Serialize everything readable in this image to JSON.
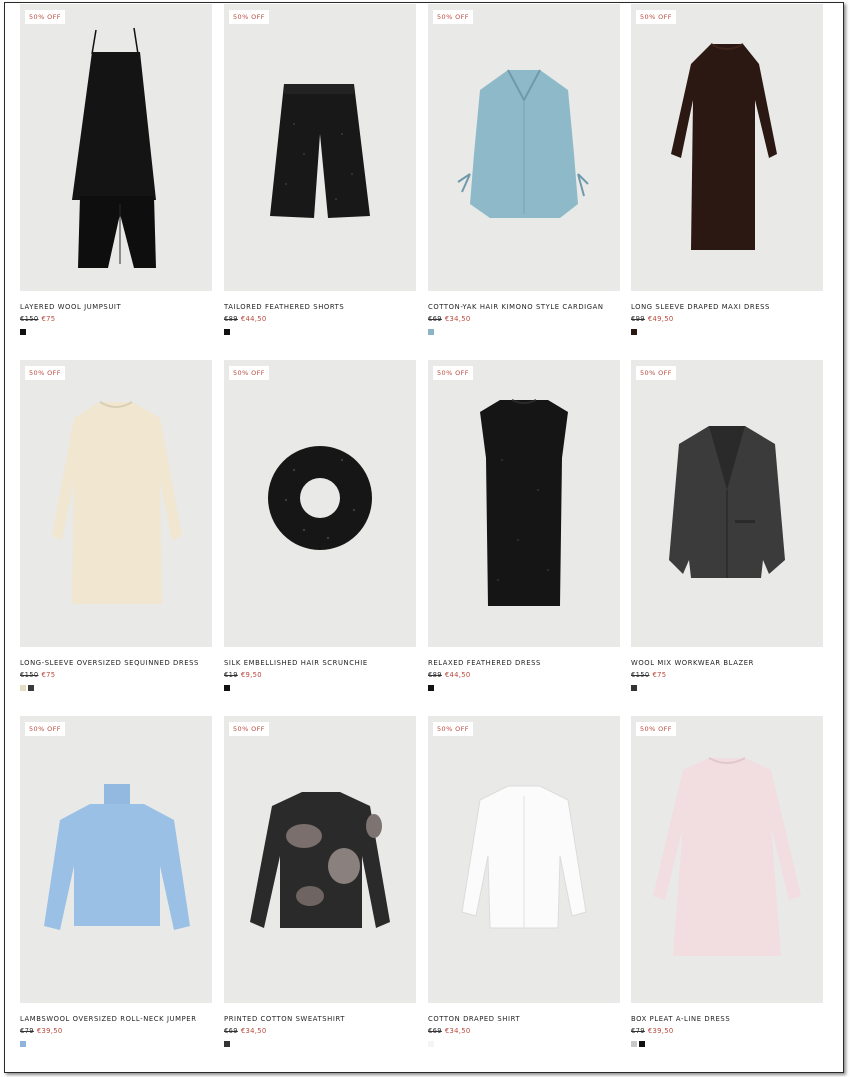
{
  "colors": {
    "sale": "#b94a3c",
    "tile_bg": "#e9e9e7"
  },
  "products": [
    {
      "badge": "50% OFF",
      "name": "LAYERED WOOL JUMPSUIT",
      "old_price": "€150",
      "new_price": "€75",
      "swatches": [
        "#111111"
      ],
      "icon": "jumpsuit-image"
    },
    {
      "badge": "50% OFF",
      "name": "TAILORED FEATHERED SHORTS",
      "old_price": "€89",
      "new_price": "€44,50",
      "swatches": [
        "#111111"
      ],
      "icon": "shorts-image"
    },
    {
      "badge": "50% OFF",
      "name": "COTTON-YAK HAIR KIMONO STYLE CARDIGAN",
      "old_price": "€69",
      "new_price": "€34,50",
      "swatches": [
        "#8cb3c4"
      ],
      "icon": "cardigan-image"
    },
    {
      "badge": "50% OFF",
      "name": "LONG SLEEVE DRAPED MAXI DRESS",
      "old_price": "€99",
      "new_price": "€49,50",
      "swatches": [
        "#2a1712"
      ],
      "icon": "maxi-dress-image"
    },
    {
      "badge": "50% OFF",
      "name": "LONG-SLEEVE OVERSIZED SEQUINNED DRESS",
      "old_price": "€150",
      "new_price": "€75",
      "swatches": [
        "#e6dcc4",
        "#3a3a3a"
      ],
      "icon": "sequin-dress-image"
    },
    {
      "badge": "50% OFF",
      "name": "SILK EMBELLISHED HAIR SCRUNCHIE",
      "old_price": "€19",
      "new_price": "€9,50",
      "swatches": [
        "#111111"
      ],
      "icon": "scrunchie-image"
    },
    {
      "badge": "50% OFF",
      "name": "RELAXED FEATHERED DRESS",
      "old_price": "€89",
      "new_price": "€44,50",
      "swatches": [
        "#111111"
      ],
      "icon": "feathered-dress-image"
    },
    {
      "badge": "50% OFF",
      "name": "WOOL MIX WORKWEAR BLAZER",
      "old_price": "€150",
      "new_price": "€75",
      "swatches": [
        "#333333"
      ],
      "icon": "blazer-image"
    },
    {
      "badge": "50% OFF",
      "name": "LAMBSWOOL OVERSIZED ROLL-NECK JUMPER",
      "old_price": "€79",
      "new_price": "€39,50",
      "swatches": [
        "#8fb4dc"
      ],
      "icon": "jumper-image"
    },
    {
      "badge": "50% OFF",
      "name": "PRINTED COTTON SWEATSHIRT",
      "old_price": "€69",
      "new_price": "€34,50",
      "swatches": [
        "#333333"
      ],
      "icon": "sweatshirt-image"
    },
    {
      "badge": "50% OFF",
      "name": "COTTON DRAPED SHIRT",
      "old_price": "€69",
      "new_price": "€34,50",
      "swatches": [
        "#f4f4f4"
      ],
      "icon": "shirt-image"
    },
    {
      "badge": "50% OFF",
      "name": "BOX PLEAT A-LINE DRESS",
      "old_price": "€79",
      "new_price": "€39,50",
      "swatches": [
        "#c8c8c8",
        "#111111"
      ],
      "icon": "aline-dress-image"
    }
  ]
}
